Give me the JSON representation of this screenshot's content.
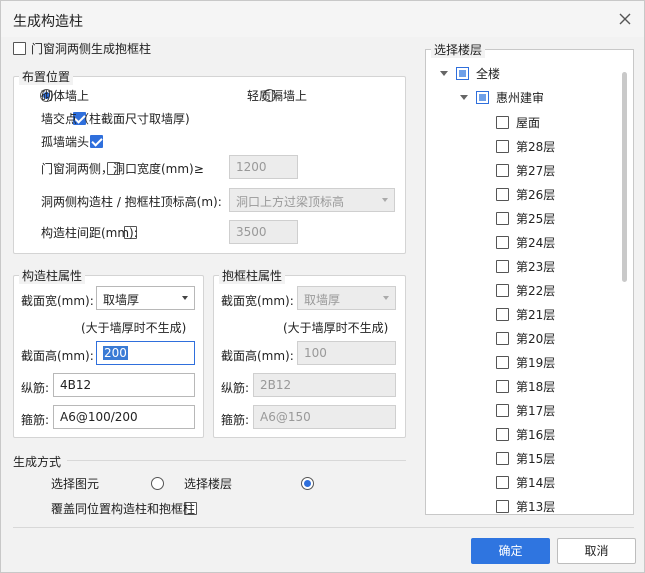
{
  "dialog": {
    "title": "生成构造柱",
    "close_icon": "close-icon"
  },
  "top_option": {
    "label": "门窗洞两侧生成抱框柱",
    "checked": false
  },
  "layout_group": {
    "title": "布置位置",
    "masonry_wall": {
      "label": "砌体墙上",
      "selected": true
    },
    "light_wall": {
      "label": "轻质隔墙上",
      "selected": false
    },
    "wall_intersection": {
      "label": "墙交点（柱截面尺寸取墙厚)",
      "checked": true
    },
    "wall_end": {
      "label": "孤墙端头",
      "checked": true
    },
    "opening_sides": {
      "label": "门窗洞两侧，洞口宽度(mm)≥",
      "checked": false,
      "value": "1200"
    },
    "top_elevation": {
      "label": "洞两侧构造柱 / 抱框柱顶标高(m):",
      "value": "洞口上方过梁顶标高"
    },
    "spacing": {
      "label": "构造柱间距(mm):",
      "checked": false,
      "value": "3500"
    }
  },
  "column_props": {
    "title": "构造柱属性",
    "width_label": "截面宽(mm):",
    "width_value": "取墙厚",
    "note": "(大于墙厚时不生成)",
    "height_label": "截面高(mm):",
    "height_value": "200",
    "long_bar_label": "纵筋:",
    "long_bar_value": "4B12",
    "stirrup_label": "箍筋:",
    "stirrup_value": "A6@100/200"
  },
  "frame_props": {
    "title": "抱框柱属性",
    "width_label": "截面宽(mm):",
    "width_value": "取墙厚",
    "note": "(大于墙厚时不生成)",
    "height_label": "截面高(mm):",
    "height_value": "100",
    "long_bar_label": "纵筋:",
    "long_bar_value": "2B12",
    "stirrup_label": "箍筋:",
    "stirrup_value": "A6@150"
  },
  "generate_mode": {
    "title": "生成方式",
    "select_elements": {
      "label": "选择图元",
      "selected": false
    },
    "select_floors": {
      "label": "选择楼层",
      "selected": true
    },
    "overwrite": {
      "label": "覆盖同位置构造柱和抱框柱",
      "checked": false
    }
  },
  "floor_tree": {
    "title": "选择楼层",
    "root": "全楼",
    "project": "惠州建审",
    "floors": [
      "屋面",
      "第28层",
      "第27层",
      "第26层",
      "第25层",
      "第24层",
      "第23层",
      "第22层",
      "第21层",
      "第20层",
      "第19层",
      "第18层",
      "第17层",
      "第16层",
      "第15层",
      "第14层",
      "第13层"
    ]
  },
  "buttons": {
    "ok": "确定",
    "cancel": "取消"
  },
  "colors": {
    "accent": "#2f75e0"
  }
}
